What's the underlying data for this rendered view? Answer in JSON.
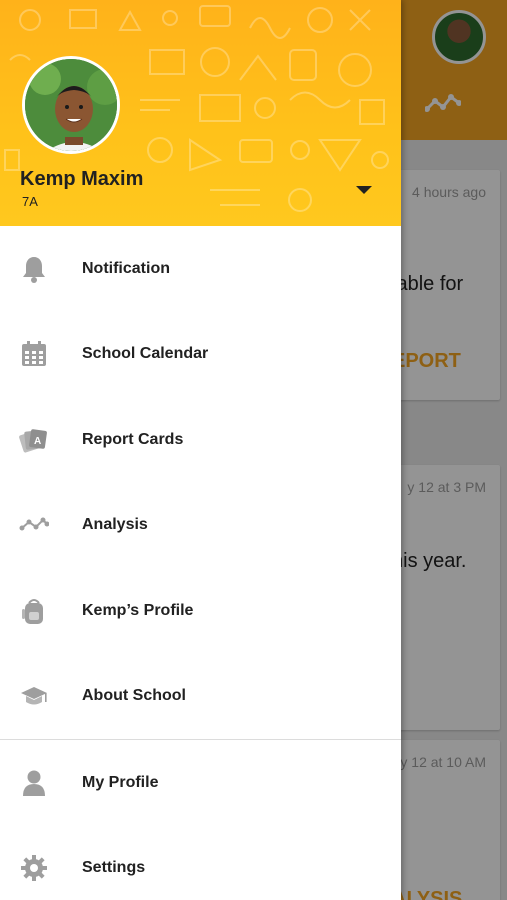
{
  "background": {
    "cards": [
      {
        "time": "4 hours ago",
        "text": "lable for",
        "action": "EPORT"
      },
      {
        "time": "y 12 at 3 PM",
        "text": "his year."
      },
      {
        "time": "y 12 at 10 AM",
        "action": "ALYSIS"
      }
    ]
  },
  "header": {
    "name": "Kemp Maxim",
    "class": "7A",
    "accent": "#ffc21a"
  },
  "menu": {
    "items": [
      {
        "label": "Notification",
        "icon": "bell-icon"
      },
      {
        "label": "School Calendar",
        "icon": "calendar-icon"
      },
      {
        "label": "Report Cards",
        "icon": "report-cards-icon"
      },
      {
        "label": "Analysis",
        "icon": "analysis-icon"
      },
      {
        "label": "Kemp’s Profile",
        "icon": "backpack-icon"
      },
      {
        "label": "About School",
        "icon": "graduation-cap-icon"
      }
    ],
    "secondary": [
      {
        "label": "My Profile",
        "icon": "person-icon"
      },
      {
        "label": "Settings",
        "icon": "gear-icon"
      }
    ]
  }
}
